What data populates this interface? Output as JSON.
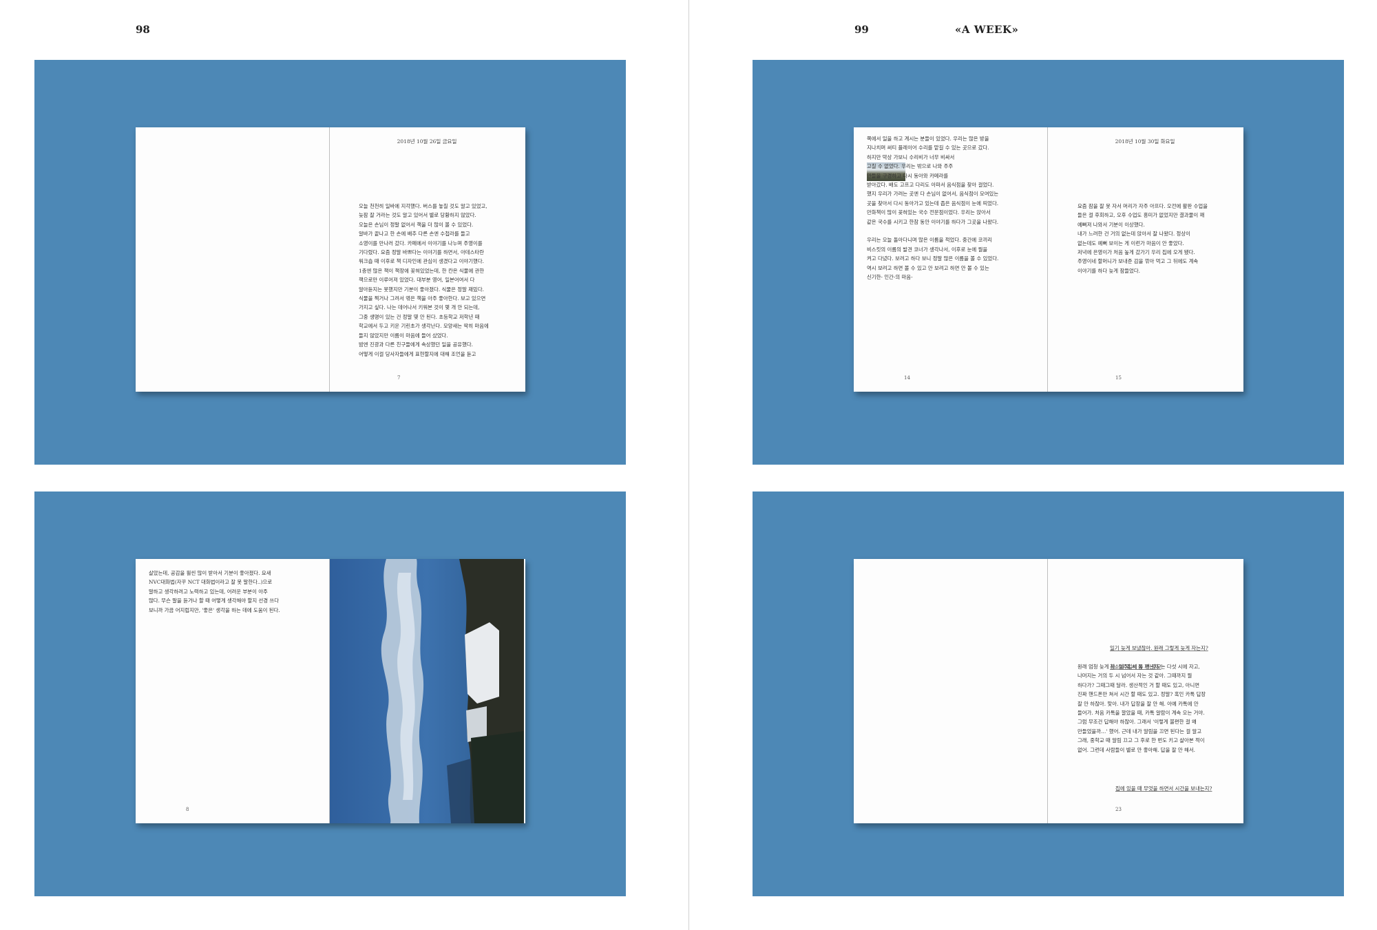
{
  "header": {
    "left_folio": "98",
    "right_folio": "99",
    "running_title": "«A WEEK»"
  },
  "spreads": [
    {
      "left": {
        "head": "",
        "text": "",
        "page_num": ""
      },
      "right": {
        "head": "2018년 10월 26일 금요일",
        "text": "오늘 천천히 일바에 지각했다. 버스를 놓칠 것도 알고 있었고,\n늦잠 잘 거라는 것도 알고 있어서 별로 당황하지 않았다.\n오늘은 손님이 정말 없어서 책을 더 많이 볼 수 있었다.\n   알바가 끝나고 한 손에 배추 다른 손엔 수첩라를 들고\n소영이를 만나러 갔다. 카페에서 이야기를 나누며 주영이를\n기다렸다. 요즘 정말 바쁘다는 이야기를 하면서, 아데스타란\n워크숍 때 이후로 책 디자인에 관심이 생겼다고 이야기했다.\n1층엔 많은 책이 책장에 꽂혀있었는데, 한 칸은 식물에 관한\n책으로만 이루어져 있었다. 대부분 영어, 일본어여서 다\n알아듣지는 못했지만 기분이 좋아졌다. 식물은 정말 재밌다.\n식물을 찍거나 그려서 엮은 책을 아주 좋아한다. 보고 있으면\n가지고 싶다. 나는 데어나서 키워본 것이 몇 개 안 되는데,\n그중 생명이 있는 건 정말 몇 안 된다. 초등학교 저학년 때\n학교에서 두고 키운 기린초가 생각난다. 모양새는 딱히 마음에\n들지 않았지만 이름이 마음에 들어 샀었다.\n   밤엔 진광과 다른 친구들에게 속상했던 일을 공유했다.\n어떻게 이걸 당사자들에게 표현할지에 대해 조언을 듣고",
        "page_num": "7"
      }
    },
    {
      "left": {
        "head": "",
        "text": "쪽에서 일을 하고 계시는 분들이 있었다. 우리는 많은 방을\n지나치며 써티 플레이어 수리를 맡길 수 있는 곳으로 갔다.\n하지만 막상 가보니 수리비가 너무 비싸서\n고칠 수 없었다. 우리는 밖으로 나와 주주\n만들을 구경하고 다시 동아와 카메라를\n받아갔다. 배도 고프고 다리도 아파서 음식점을 찾아 걸었다.\n했지 우리가 가려는 곳엔 다 손님이 없어서, 음식점이 모여있는\n곳을 찾아서 다시 동아가고 있는데 좁은 음식점이 눈에 띄었다.\n만화책이 많이 꽂혀있는 국수 전문점이었다. 우리는 앉아서\n같은 국수를 시키고 한참 동안 이야기를 하다가 그곳을 나왔다.\n\n우리는 오늘 돌아다니며 많은 이름을 적었다. 중간에 코끼리\n비스킷의 이름의 발견 코너가 생각나서, 이후로 눈에 뭘을\n켜고 다녔다. 보려고 하다 보니 정말 많은 이름을 볼 수 있었다.\n역시 보려고 하면 볼 수 있고 안 보려고 하면 안 볼 수 있는\n신기한- 인간-의 마음-",
        "page_num": "14"
      },
      "right": {
        "head": "2018년 10월 30일 화요일",
        "text": "요즘 잠을 잘 못 자서 머리가 자주 아프다. 오전에 활판 수업을\n들은 걸 후회하고, 오후 수업도 흥미가 없었지만 결과물이 꽤\n예뻐져 나와서 기분이 이상했다.\n   내가 느려한 건 거의 없는데 앉아서 잘 나왔다. 정상이\n없는데도 예뻐 보이는 게 이런가 마음이 안 좋았다.\n   저녁에 은영이가 처음 높게 갔가기 우리 집에 오게 됐다.\n주영이네 할머니가 보내준 감을 깎아 먹고 그 뒤에도 계속\n이야기를 하다 늦게 잠들었다.",
        "page_num": "15"
      }
    },
    {
      "left": {
        "head": "",
        "text": "살았는데, 공감을 훨씬 많이 받아서 기분이 좋아졌다. 요새\nNVC대화법(자꾸 NCT 대화법이라고 잘 못 말한다..)으로\n말하고 생각하려고 노력하고 있는데, 어려운 부분이 아주\n많다. 무슨 말을 듣거나 할 때 어떻게 생각해야 할지 선경 쓰다\n보니까 가끔 어지럽지만, '좋은' 생각을 하는 데에 도움이 된다.",
        "page_num": "8"
      },
      "right": {
        "head": "",
        "text": "",
        "page_num": ""
      }
    },
    {
      "left": {
        "head": "",
        "text": "",
        "page_num": ""
      },
      "right": {
        "head": "",
        "question1a": "일기 늦게 보냈잖아. 원래 그렇게 늦게 자는지?",
        "question1b": "청소에 몇 시 쯤 자는지?",
        "text": "원래 엄청 늦게 자. 일주일에 두 번 정도는 다섯 시에 자고,\n나머지는 거의 두 시 넘어서 자는 것 같아. 그때까지 뭘\n하다가? 그때그때 달라. 생산적인 거 할 때도 있고, 아니면\n진짜 핸드폰만 쳐서 시간 할 때도 있고. 정말? 혹인 카톡 답장\n잘 안 하잖아. 맞아. 내가 답장을 잘 안 해. 아예 카톡에 안\n들어가. 처음 카톡을 깔았을 때, 카톡 알람이 계속 오는 거야.\n그럼 무조건 답해야 하잖아. 그래서 '이렇게 불편한 걸 왜\n만들었을까…' 했어. 근데 내가 알림을 끄면 된다는 걸 알고\n그래, 중학교 때 알림 끄고 그 후로 한 번도 키고 살아본 적이\n없어. 그런데 사람들이 별로 안 좋아해. 답을 잘 안 해서.",
        "question2": "집에 있을 때 무엇을 하면서 시간을 보내는지?",
        "page_num": "23"
      }
    }
  ]
}
